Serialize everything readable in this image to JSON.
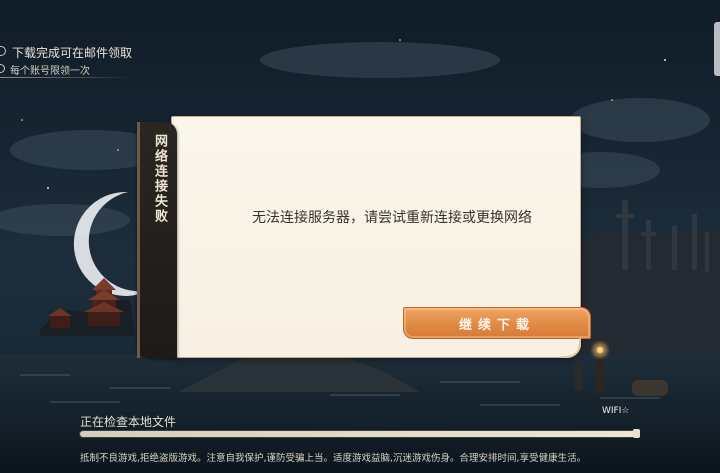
{
  "mail_notice": {
    "line1": "下载完成可在邮件领取",
    "line2": "每个账号限领一次"
  },
  "dialog": {
    "title": "网络连接失败",
    "message": "无法连接服务器，请尝试重新连接或更换网络",
    "continue_button": "继续下载"
  },
  "progress": {
    "label": "正在检查本地文件",
    "network": "WIFI☆",
    "percent": 100
  },
  "health_notice": "抵制不良游戏,拒绝盗版游戏。注意自我保护,谨防受骗上当。适度游戏益脑,沉迷游戏伤身。合理安排时间,享受健康生活。"
}
